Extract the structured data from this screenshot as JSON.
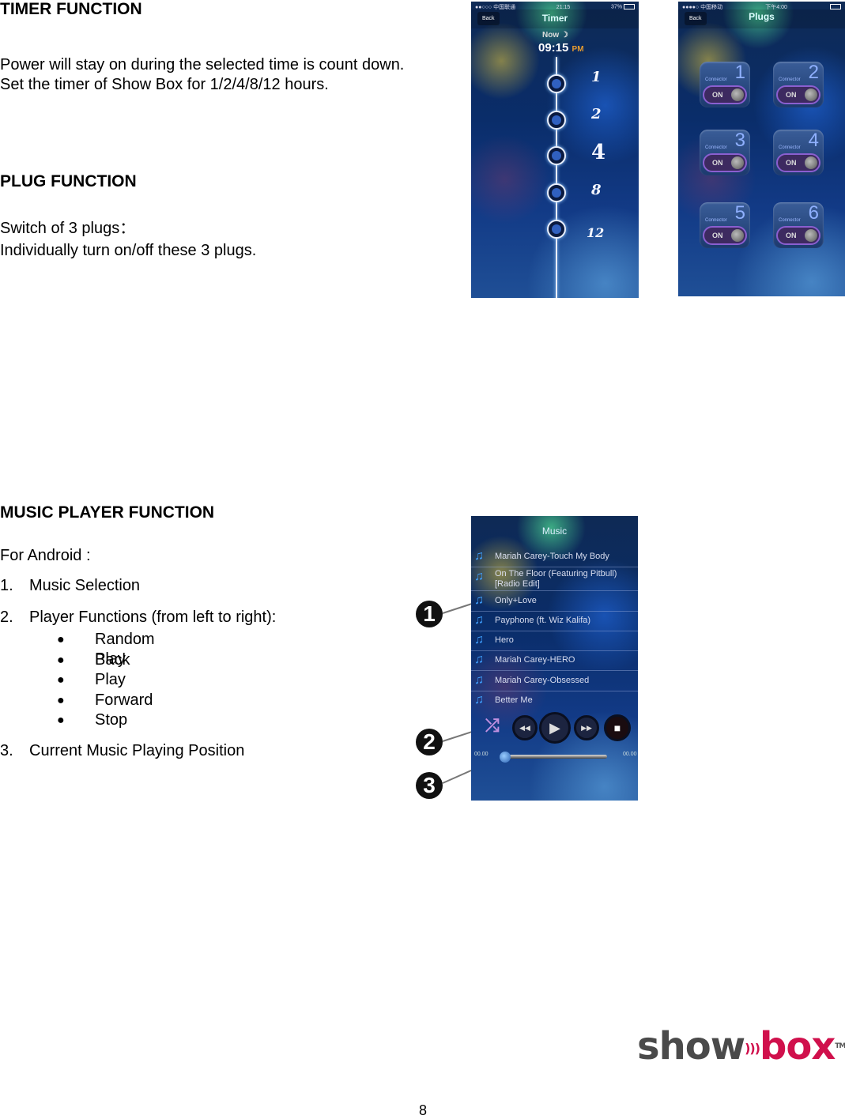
{
  "timer_section": {
    "heading": "TIMER FUNCTION",
    "line1": "Power will stay on during the selected time is count down.",
    "line2": "Set the timer of Show Box for 1/2/4/8/12 hours."
  },
  "plug_section": {
    "heading": "PLUG FUNCTION",
    "line1": "Switch of 3 plugs：",
    "line2": "Individually turn on/off these 3 plugs."
  },
  "music_section": {
    "heading": "MUSIC PLAYER FUNCTION",
    "platform": "For Android :",
    "items": [
      {
        "num": "1.",
        "label": "Music Selection"
      },
      {
        "num": "2.",
        "label": "Player Functions (from left to right):"
      },
      {
        "num": "3.",
        "label": "Current Music Playing Position"
      }
    ],
    "bullets": [
      "Random Play",
      "Back",
      "Play",
      "Forward",
      "Stop"
    ],
    "callouts": [
      "1",
      "2",
      "3"
    ]
  },
  "timer_screen": {
    "status_left": "●●○○○ 中国联通",
    "status_time": "21:15",
    "status_right": "37%",
    "back": "Back",
    "title": "Timer",
    "now_label": "Now ☽",
    "now_time": "09:15",
    "now_ampm": "PM",
    "options": [
      "1",
      "2",
      "4",
      "8",
      "12"
    ]
  },
  "plugs_screen": {
    "status_left": "●●●●○ 中国移动",
    "status_time": "下午4:00",
    "back": "Back",
    "title": "Plugs",
    "connector_label": "Connector",
    "connectors": [
      {
        "num": "1",
        "state": "ON"
      },
      {
        "num": "2",
        "state": "ON"
      },
      {
        "num": "3",
        "state": "ON"
      },
      {
        "num": "4",
        "state": "ON"
      },
      {
        "num": "5",
        "state": "ON"
      },
      {
        "num": "6",
        "state": "ON"
      }
    ]
  },
  "music_screen": {
    "title": "Music",
    "songs": [
      "Mariah Carey-Touch My Body",
      "On The Floor (Featuring Pitbull) [Radio Edit]",
      "Only+Love",
      "Payphone (ft. Wiz Kalifa)",
      "Hero",
      "Mariah Carey-HERO",
      "Mariah Carey-Obsessed",
      "Better Me"
    ],
    "time_start": "00.00",
    "time_end": "00.00",
    "progress": 0
  },
  "logo": {
    "part1": "show",
    "part2": "box",
    "tm": "TM",
    "color_dark": "#4a4a4a",
    "color_accent": "#d0104c"
  },
  "page_number": "8"
}
